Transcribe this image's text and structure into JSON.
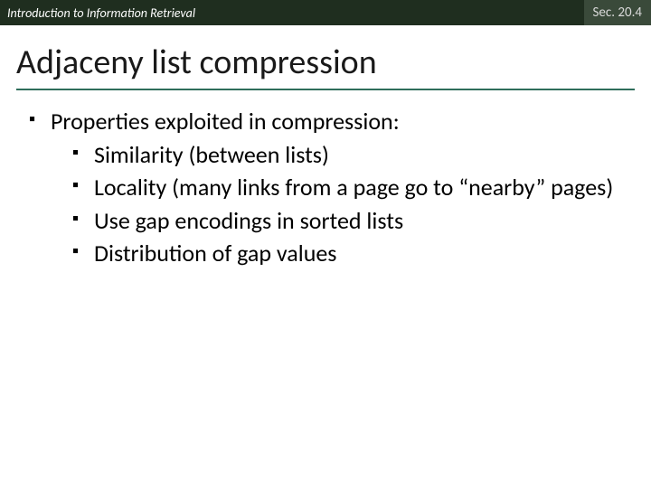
{
  "header": {
    "left": "Introduction to Information Retrieval",
    "right": "Sec. 20.4"
  },
  "title": "Adjaceny list compression",
  "bullets": {
    "main": "Properties exploited in compression:",
    "subs": [
      "Similarity (between lists)",
      "Locality (many links from a page go to “nearby” pages)",
      "Use gap encodings in sorted lists",
      "Distribution of gap values"
    ]
  }
}
